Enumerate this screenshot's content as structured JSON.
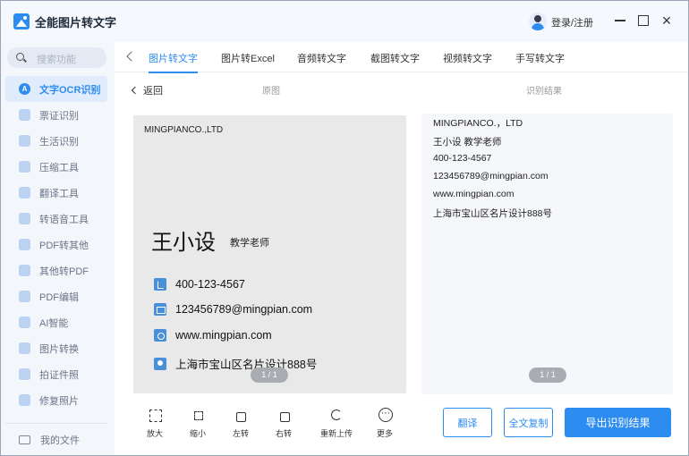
{
  "app": {
    "title": "全能图片转文字"
  },
  "header": {
    "login_label": "登录/注册"
  },
  "search": {
    "placeholder": "搜索功能"
  },
  "sidebar": {
    "items": [
      {
        "label": "文字OCR识别",
        "active": true,
        "icon": "ocr-icon"
      },
      {
        "label": "票证识别",
        "icon": "ticket-icon"
      },
      {
        "label": "生活识别",
        "icon": "life-icon"
      },
      {
        "label": "压缩工具",
        "icon": "compress-icon"
      },
      {
        "label": "翻译工具",
        "icon": "translate-icon"
      },
      {
        "label": "转语音工具",
        "icon": "voice-icon"
      },
      {
        "label": "PDF转其他",
        "icon": "pdf-icon"
      },
      {
        "label": "其他转PDF",
        "icon": "to-pdf-icon"
      },
      {
        "label": "PDF编辑",
        "icon": "pdf-edit-icon"
      },
      {
        "label": "AI智能",
        "icon": "ai-icon"
      },
      {
        "label": "图片转换",
        "icon": "image-convert-icon"
      },
      {
        "label": "拍证件照",
        "icon": "id-photo-icon"
      },
      {
        "label": "修复照片",
        "icon": "repair-icon"
      }
    ],
    "my_files": "我的文件"
  },
  "tabs": [
    {
      "label": "图片转文字",
      "active": true
    },
    {
      "label": "图片转Excel"
    },
    {
      "label": "音频转文字"
    },
    {
      "label": "截图转文字"
    },
    {
      "label": "视频转文字"
    },
    {
      "label": "手写转文字"
    }
  ],
  "subbar": {
    "back_label": "返回",
    "original_label": "原图",
    "result_label": "识别结果"
  },
  "card": {
    "company": "MINGPIANCO.,LTD",
    "name": "王小设",
    "title": "教学老师",
    "phone": "400-123-4567",
    "email": "123456789@mingpian.com",
    "website": "www.mingpian.com",
    "address": "上海市宝山区名片设计888号",
    "page": "1 / 1"
  },
  "result": {
    "lines": [
      "MINGPIANCO.，LTD",
      "王小设 教学老师",
      "400-123-4567",
      "123456789@mingpian.com",
      "www.mingpian.com",
      "上海市宝山区名片设计888号"
    ],
    "page": "1 / 1"
  },
  "toolbar": {
    "zoom_in": "放大",
    "zoom_out": "缩小",
    "rotate_left": "左转",
    "rotate_right": "右转",
    "reupload": "重新上传",
    "more": "更多"
  },
  "actions": {
    "translate": "翻译",
    "copy_all": "全文复制",
    "export": "导出识别结果"
  },
  "colors": {
    "accent": "#2d8cf0",
    "sidebar_bg": "#f3f6fb",
    "active_bg": "#e0ebfb"
  }
}
